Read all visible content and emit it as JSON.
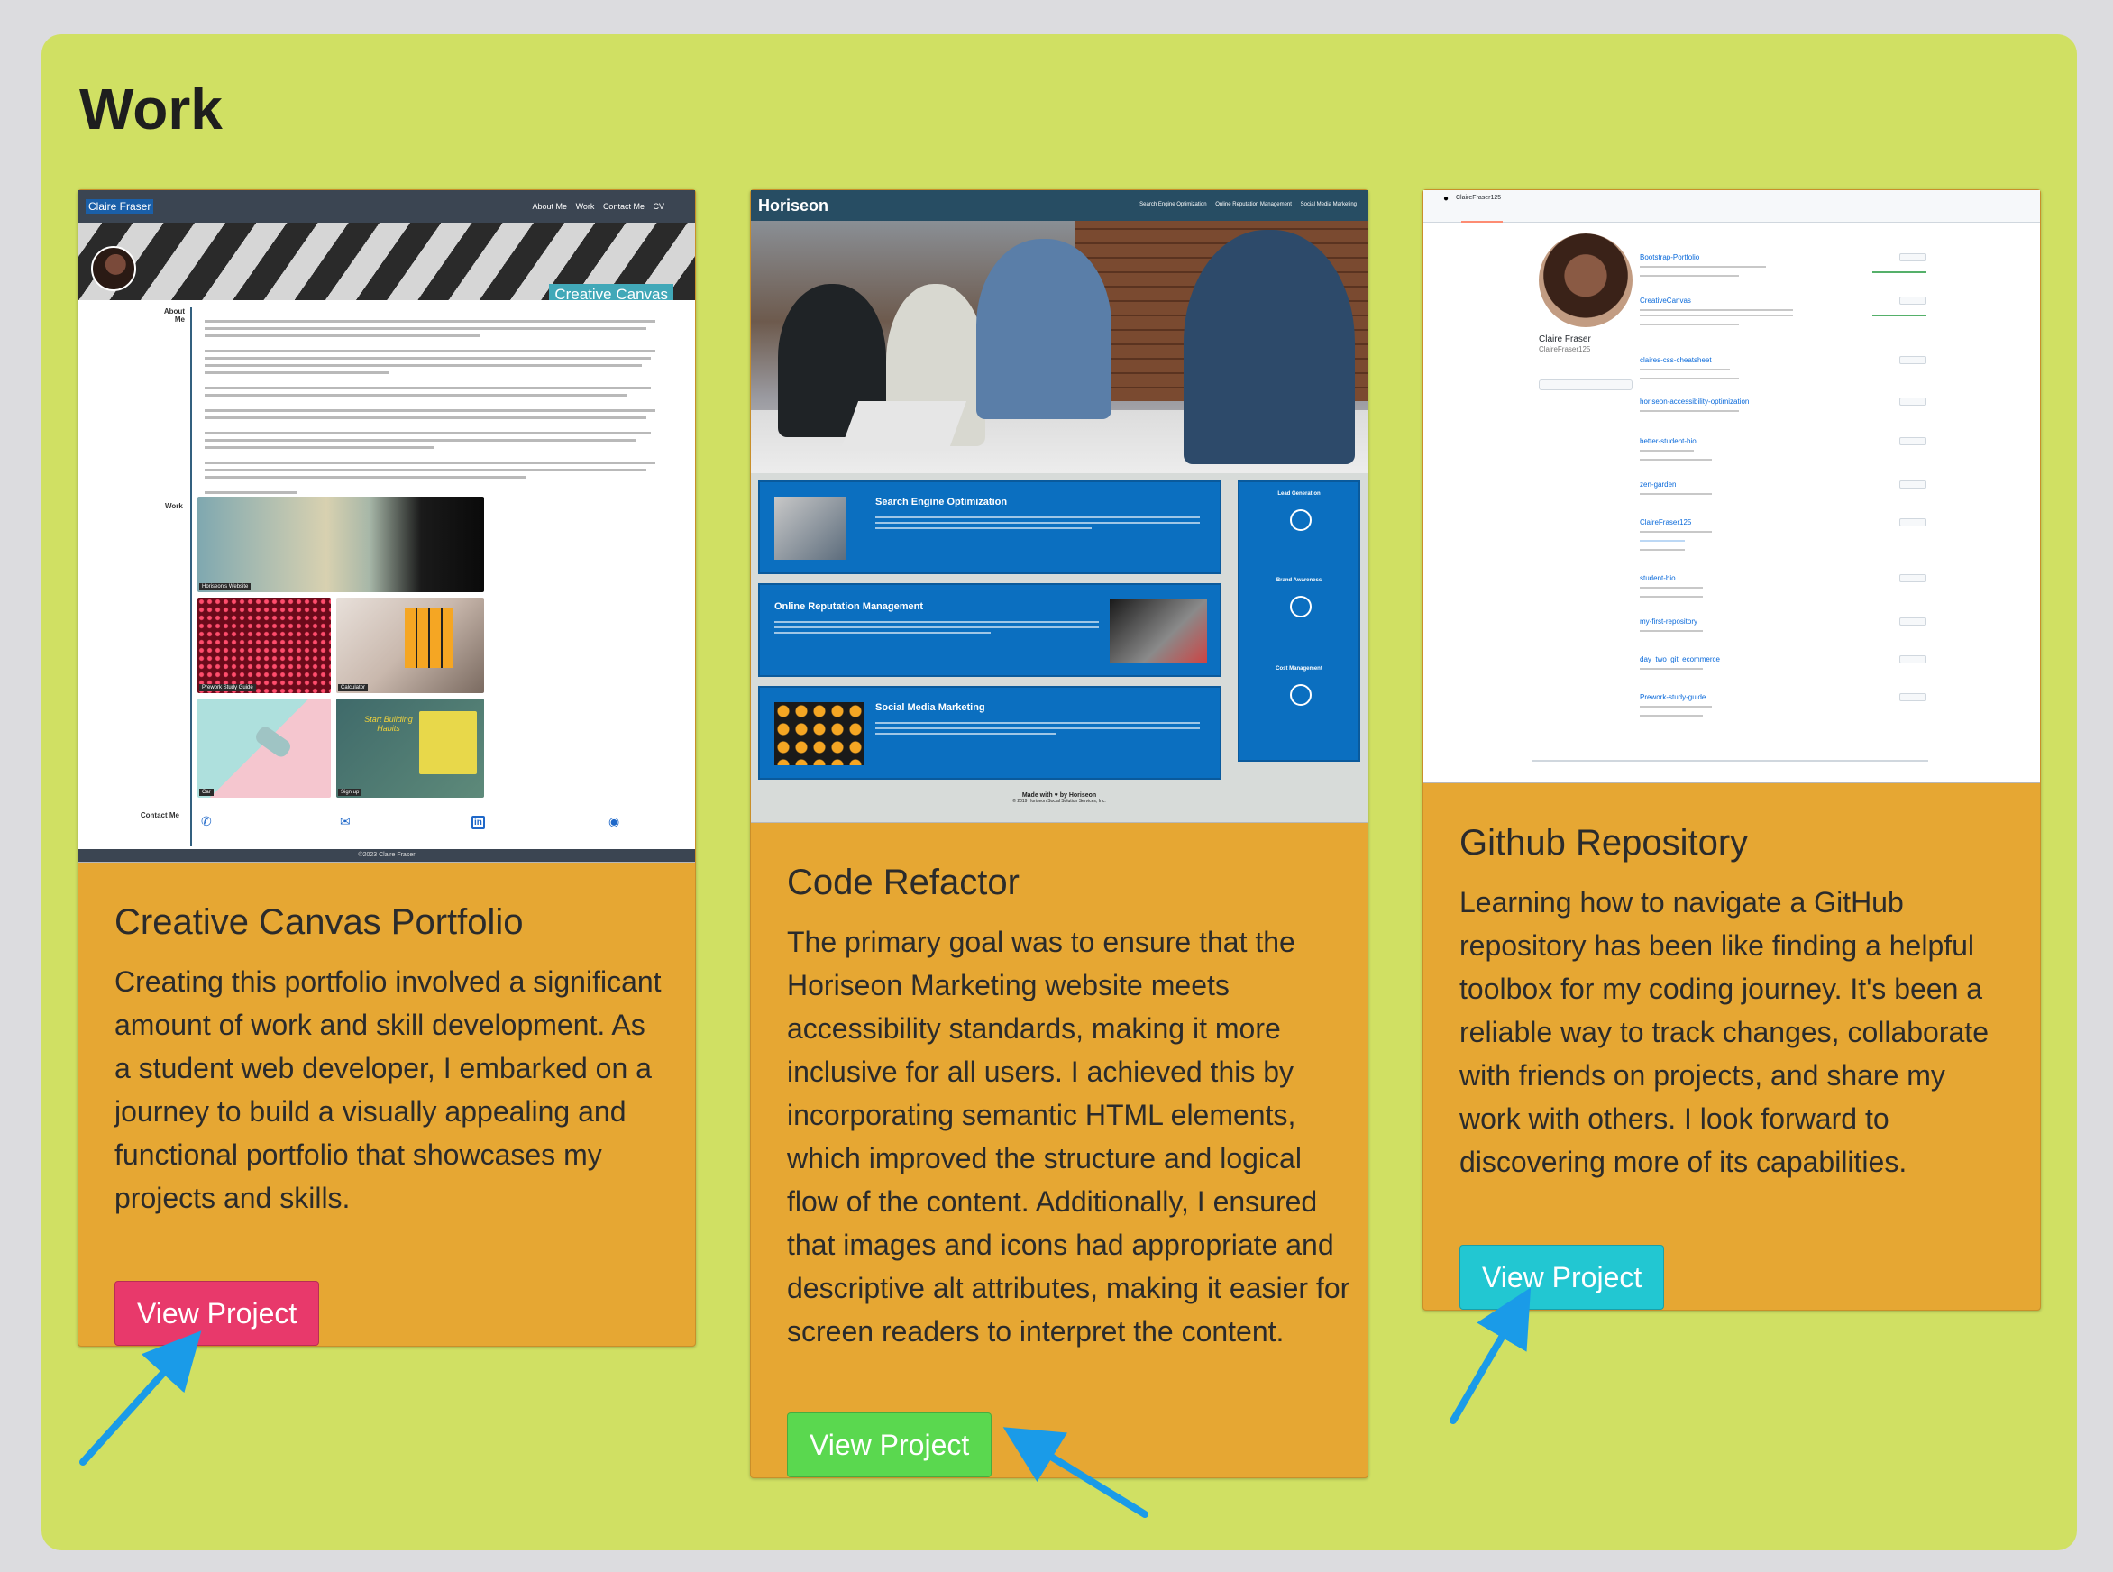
{
  "section": {
    "title": "Work",
    "bg_color": "#d0e063"
  },
  "cards": [
    {
      "title": "Creative Canvas Portfolio",
      "description": "Creating this portfolio involved a significant amount of work and skill development. As a student web developer, I embarked on a journey to build a visually appealing and functional portfolio that showcases my projects and skills.",
      "button_label": "View Project",
      "button_color": "#e8396b",
      "screenshot": {
        "brand": "Claire Fraser",
        "nav_links": [
          "About Me",
          "Work",
          "Contact Me",
          "CV"
        ],
        "banner_title": "Creative Canvas",
        "about_label": "About Me",
        "work_label": "Work",
        "contact_label": "Contact Me",
        "project_labels": [
          "Horiseon's Website",
          "Prework Study Guide",
          "Calculator",
          "Car",
          "Sign up"
        ],
        "sign_up_heading": "Start Building Habits",
        "footer": "©2023 Claire Fraser"
      }
    },
    {
      "title": "Code Refactor",
      "description": "The primary goal was to ensure that the Horiseon Marketing website meets accessibility standards, making it more inclusive for all users. I achieved this by incorporating semantic HTML elements, which improved the structure and logical flow of the content. Additionally, I ensured that images and icons had appropriate and descriptive alt attributes, making it easier for screen readers to interpret the content.",
      "button_label": "View Project",
      "button_color": "#5ad84f",
      "screenshot": {
        "brand": "Horiseon",
        "nav_links": [
          "Search Engine Optimization",
          "Online Reputation Management",
          "Social Media Marketing"
        ],
        "sections": [
          "Search Engine Optimization",
          "Online Reputation Management",
          "Social Media Marketing"
        ],
        "benefits": [
          "Lead Generation",
          "Brand Awareness",
          "Cost Management"
        ],
        "footer_made_with": "Made with ♥ by Horiseon",
        "footer_copyright": "© 2019 Horiseon Social Solution Services, Inc."
      }
    },
    {
      "title": "Github Repository",
      "description": "Learning how to navigate a GitHub repository has been like finding a helpful toolbox for my coding journey. It's been a reliable way to track changes, collaborate with friends on projects, and share my work with others. I look forward to discovering more of its capabilities.",
      "button_label": "View Project",
      "button_color": "#22c7d2",
      "screenshot": {
        "user_handle": "ClaireFraser125",
        "profile_name": "Claire Fraser",
        "repositories": [
          "Bootstrap-Portfolio",
          "CreativeCanvas",
          "claires-css-cheatsheet",
          "horiseon-accessibility-optimization",
          "better-student-bio",
          "zen-garden",
          "ClaireFraser125",
          "student-bio",
          "my-first-repository",
          "day_two_git_ecommerce",
          "Prework-study-guide"
        ]
      }
    }
  ],
  "annotation_color": "#1a9be8"
}
